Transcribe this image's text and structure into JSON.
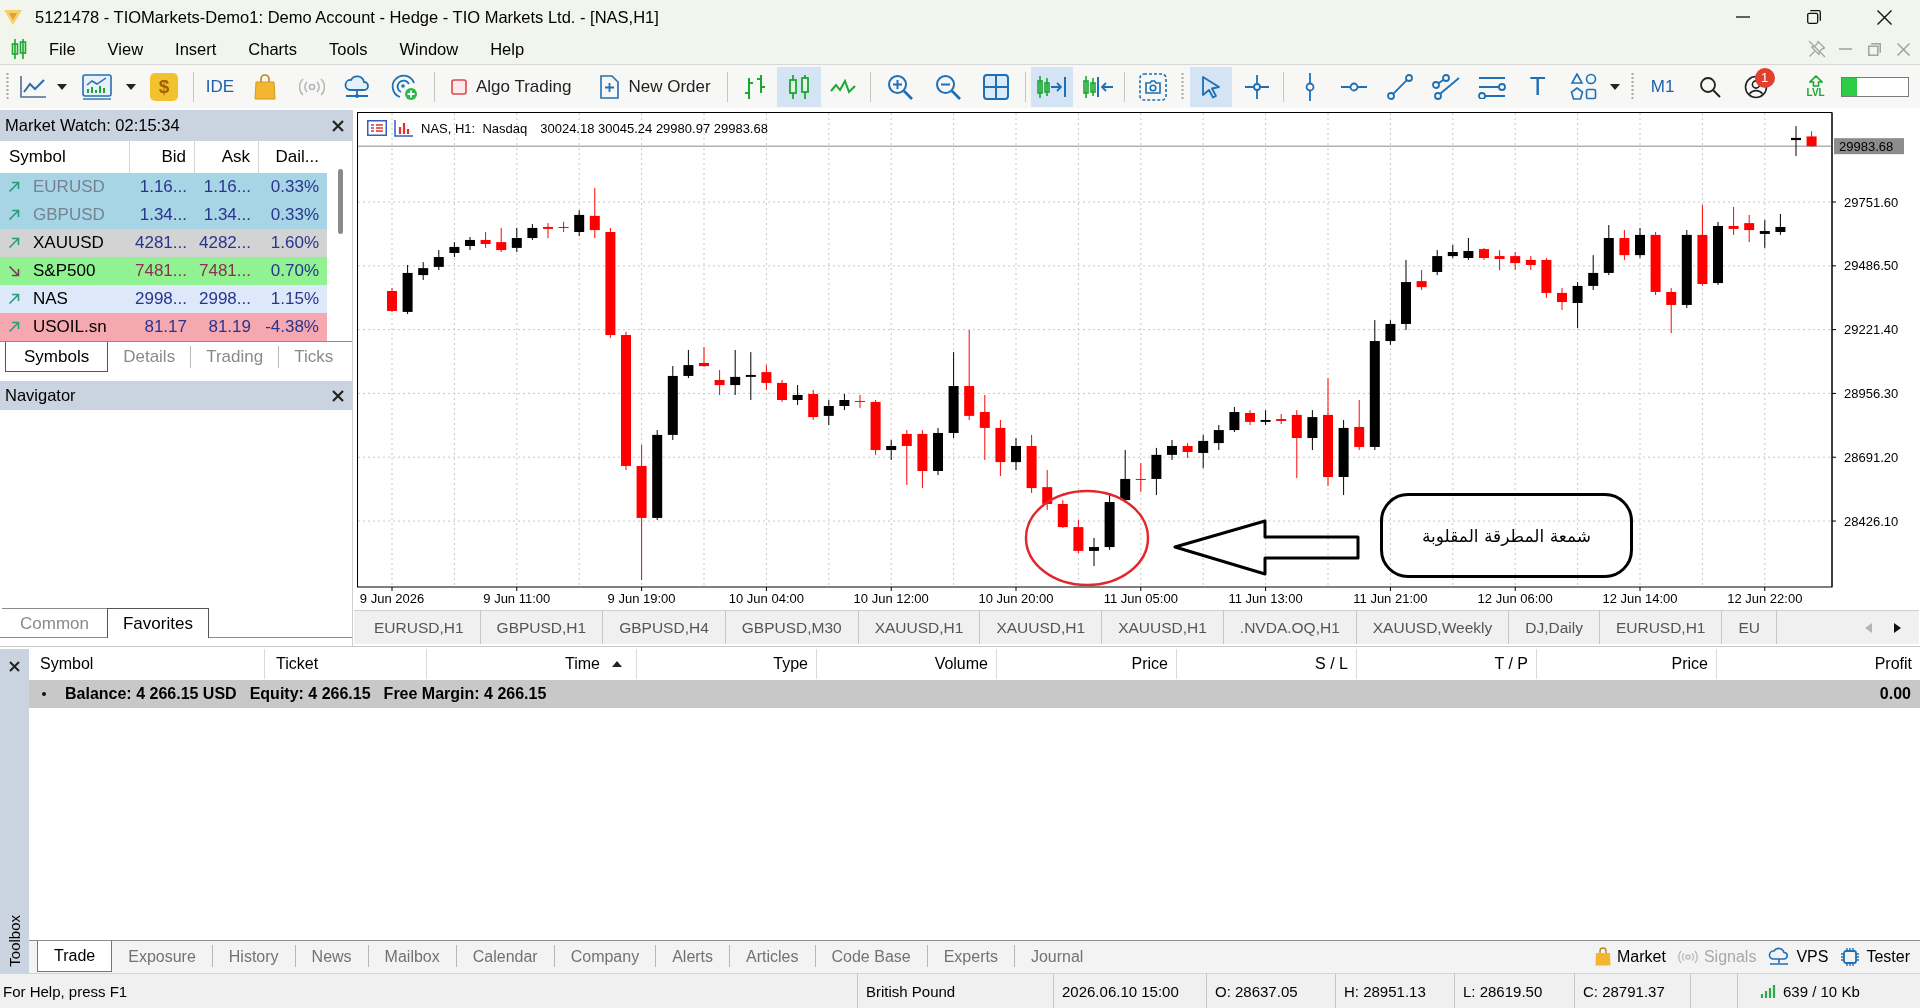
{
  "window": {
    "title": "5121478 - TIOMarkets-Demo1: Demo Account - Hedge - TIO Markets Ltd. - [NAS,H1]"
  },
  "menu": [
    "File",
    "View",
    "Insert",
    "Charts",
    "Tools",
    "Window",
    "Help"
  ],
  "toolbar": {
    "dollar_glyph": "$",
    "ide": "IDE",
    "algo_trading": {
      "label": "Algo Trading",
      "on": false
    },
    "new_order": "New Order",
    "chart_types": [
      {
        "kind": "bars",
        "selected": false
      },
      {
        "kind": "candles",
        "selected": true
      },
      {
        "kind": "line",
        "selected": false
      }
    ],
    "chart_shift": {
      "on": true
    },
    "autoscroll": {
      "on": false
    },
    "pointer_tools": [
      {
        "kind": "cursor",
        "selected": true
      },
      {
        "kind": "crosshair",
        "selected": false
      }
    ],
    "text_tool_glyph": "T",
    "timeframe": "M1",
    "notification_count": "1",
    "lvl": "LVL",
    "meter": {
      "level": 0.23
    }
  },
  "market_watch": {
    "title": "Market Watch: 02:15:34",
    "columns": [
      "Symbol",
      "Bid",
      "Ask",
      "Dail..."
    ],
    "rows": [
      {
        "symbol": "EURUSD",
        "bid": "1.16...",
        "ask": "1.16...",
        "daily": "0.33%",
        "rising": true,
        "dimmed": true,
        "color": "#a8d5e5"
      },
      {
        "symbol": "GBPUSD",
        "bid": "1.34...",
        "ask": "1.34...",
        "daily": "0.33%",
        "rising": true,
        "dimmed": true,
        "color": "#a8d5e5"
      },
      {
        "symbol": "XAUUSD",
        "bid": "4281...",
        "ask": "4282...",
        "daily": "1.60%",
        "rising": true,
        "dimmed": false,
        "color": "#d3d3d3"
      },
      {
        "symbol": "S&P500",
        "bid": "7481...",
        "ask": "7481...",
        "daily": "0.70%",
        "rising": false,
        "dimmed": false,
        "color": "#90f290"
      },
      {
        "symbol": "NAS",
        "bid": "2998...",
        "ask": "2998...",
        "daily": "1.15%",
        "rising": true,
        "dimmed": false,
        "color": "#dde9f8"
      },
      {
        "symbol": "USOIL.sn",
        "bid": "81.17",
        "ask": "81.19",
        "daily": "-4.38%",
        "rising": true,
        "dimmed": false,
        "color": "#f6a8b0"
      }
    ],
    "tabs": [
      {
        "label": "Symbols",
        "selected": true
      },
      {
        "label": "Details",
        "selected": false
      },
      {
        "label": "Trading",
        "selected": false
      },
      {
        "label": "Ticks",
        "selected": false
      }
    ]
  },
  "navigator": {
    "title": "Navigator",
    "tabs": [
      {
        "label": "Common",
        "selected": false
      },
      {
        "label": "Favorites",
        "selected": true
      }
    ]
  },
  "chart": {
    "header": "NAS, H1:  Nasdaq",
    "readout": "30024.18 30045.24 29980.97 29983.68",
    "chart_data": [
      {
        "type": "candlestick",
        "categories": [
          "9 Jun 2026",
          null,
          null,
          null,
          null,
          null,
          null,
          null,
          "9 Jun 11:00",
          null,
          null,
          null,
          null,
          null,
          null,
          null,
          "9 Jun 19:00",
          null,
          null,
          null,
          null,
          null,
          null,
          null,
          "10 Jun 04:00",
          null,
          null,
          null,
          null,
          null,
          null,
          null,
          "10 Jun 12:00",
          null,
          null,
          null,
          null,
          null,
          null,
          null,
          "10 Jun 20:00",
          null,
          null,
          null,
          null,
          null,
          null,
          null,
          "11 Jun 05:00",
          null,
          null,
          null,
          null,
          null,
          null,
          null,
          "11 Jun 13:00",
          null,
          null,
          null,
          null,
          null,
          null,
          null,
          "11 Jun 21:00",
          null,
          null,
          null,
          null,
          null,
          null,
          null,
          "12 Jun 06:00",
          null,
          null,
          null,
          null,
          null,
          null,
          null,
          "12 Jun 14:00",
          null,
          null,
          null,
          null,
          null,
          null,
          null,
          "12 Jun 22:00",
          null,
          null,
          null
        ],
        "ohlc": [
          [
            29382,
            29394,
            29295,
            29299
          ],
          [
            29295,
            29490,
            29286,
            29457
          ],
          [
            29448,
            29502,
            29428,
            29477
          ],
          [
            29482,
            29552,
            29469,
            29523
          ],
          [
            29540,
            29585,
            29523,
            29565
          ],
          [
            29569,
            29606,
            29552,
            29594
          ],
          [
            29594,
            29627,
            29561,
            29577
          ],
          [
            29585,
            29644,
            29544,
            29552
          ],
          [
            29561,
            29644,
            29544,
            29602
          ],
          [
            29602,
            29660,
            29594,
            29644
          ],
          [
            29648,
            29664,
            29602,
            29640
          ],
          [
            29648,
            29669,
            29627,
            29644
          ],
          [
            29627,
            29718,
            29610,
            29698
          ],
          [
            29694,
            29810,
            29602,
            29635
          ],
          [
            29627,
            29644,
            29187,
            29199
          ],
          [
            29199,
            29212,
            28638,
            28655
          ],
          [
            28655,
            28742,
            28181,
            28439
          ],
          [
            28439,
            28804,
            28430,
            28784
          ],
          [
            28784,
            29070,
            28763,
            29029
          ],
          [
            29029,
            29137,
            29020,
            29074
          ],
          [
            29083,
            29149,
            29066,
            29070
          ],
          [
            29012,
            29054,
            28950,
            28991
          ],
          [
            28991,
            29137,
            28950,
            29025
          ],
          [
            29025,
            29128,
            28929,
            29033
          ],
          [
            29045,
            29074,
            28971,
            29000
          ],
          [
            29000,
            29012,
            28921,
            28929
          ],
          [
            28929,
            28991,
            28908,
            28950
          ],
          [
            28954,
            28971,
            28846,
            28858
          ],
          [
            28863,
            28929,
            28825,
            28904
          ],
          [
            28904,
            28954,
            28887,
            28929
          ],
          [
            28925,
            28950,
            28896,
            28921
          ],
          [
            28921,
            28929,
            28701,
            28721
          ],
          [
            28721,
            28763,
            28680,
            28738
          ],
          [
            28788,
            28804,
            28576,
            28738
          ],
          [
            28788,
            28804,
            28563,
            28634
          ],
          [
            28634,
            28813,
            28617,
            28792
          ],
          [
            28792,
            29128,
            28771,
            28987
          ],
          [
            28987,
            29220,
            28846,
            28863
          ],
          [
            28879,
            28950,
            28680,
            28813
          ],
          [
            28813,
            28846,
            28613,
            28671
          ],
          [
            28671,
            28771,
            28638,
            28738
          ],
          [
            28738,
            28784,
            28543,
            28563
          ],
          [
            28567,
            28638,
            28472,
            28497
          ],
          [
            28497,
            28513,
            28397,
            28401
          ],
          [
            28401,
            28430,
            28293,
            28302
          ],
          [
            28302,
            28356,
            28239,
            28318
          ],
          [
            28318,
            28543,
            28306,
            28505
          ],
          [
            28513,
            28721,
            28501,
            28601
          ],
          [
            28601,
            28667,
            28547,
            28597
          ],
          [
            28601,
            28730,
            28534,
            28701
          ],
          [
            28701,
            28763,
            28680,
            28738
          ],
          [
            28738,
            28750,
            28688,
            28713
          ],
          [
            28709,
            28784,
            28646,
            28759
          ],
          [
            28750,
            28825,
            28721,
            28804
          ],
          [
            28804,
            28900,
            28796,
            28879
          ],
          [
            28875,
            28887,
            28825,
            28838
          ],
          [
            28838,
            28887,
            28825,
            28846
          ],
          [
            28850,
            28871,
            28829,
            28842
          ],
          [
            28867,
            28887,
            28605,
            28771
          ],
          [
            28771,
            28887,
            28721,
            28858
          ],
          [
            28867,
            29020,
            28572,
            28609
          ],
          [
            28609,
            28846,
            28534,
            28813
          ],
          [
            28817,
            28929,
            28721,
            28734
          ],
          [
            28734,
            29261,
            28721,
            29174
          ],
          [
            29174,
            29261,
            29158,
            29245
          ],
          [
            29245,
            29511,
            29220,
            29419
          ],
          [
            29423,
            29469,
            29386,
            29398
          ],
          [
            29461,
            29552,
            29448,
            29527
          ],
          [
            29527,
            29573,
            29519,
            29544
          ],
          [
            29519,
            29602,
            29511,
            29548
          ],
          [
            29556,
            29561,
            29511,
            29519
          ],
          [
            29527,
            29552,
            29469,
            29515
          ],
          [
            29527,
            29544,
            29469,
            29498
          ],
          [
            29511,
            29527,
            29469,
            29490
          ],
          [
            29511,
            29519,
            29353,
            29374
          ],
          [
            29374,
            29394,
            29303,
            29336
          ],
          [
            29332,
            29419,
            29228,
            29403
          ],
          [
            29403,
            29531,
            29386,
            29457
          ],
          [
            29457,
            29656,
            29448,
            29602
          ],
          [
            29602,
            29635,
            29511,
            29531
          ],
          [
            29531,
            29644,
            29519,
            29615
          ],
          [
            29615,
            29627,
            29365,
            29378
          ],
          [
            29378,
            29394,
            29207,
            29324
          ],
          [
            29324,
            29635,
            29311,
            29615
          ],
          [
            29615,
            29739,
            29403,
            29411
          ],
          [
            29415,
            29669,
            29407,
            29652
          ],
          [
            29652,
            29731,
            29615,
            29640
          ],
          [
            29664,
            29698,
            29585,
            29635
          ],
          [
            29619,
            29677,
            29561,
            29631
          ],
          [
            29627,
            29702,
            29615,
            29648
          ],
          [
            30009,
            30067,
            29943,
            30018
          ],
          [
            30024.18,
            30045.24,
            29980.97,
            29983.68
          ]
        ],
        "yticks": [
          {
            "value": 28426.1,
            "label": "28426.10"
          },
          {
            "value": 28691.2,
            "label": "28691.20"
          },
          {
            "value": 28956.3,
            "label": "28956.30"
          },
          {
            "value": 29221.4,
            "label": "29221.40"
          },
          {
            "value": 29486.5,
            "label": "29486.50"
          },
          {
            "value": 29751.6,
            "label": "29751.60"
          }
        ],
        "ylim": [
          28152,
          30134
        ],
        "grid": true,
        "ref_lines": [
          {
            "axis": "y",
            "value": 29983.68,
            "label": "29983.68",
            "color": "#8c8c8c"
          }
        ],
        "annotations": [
          "شمعة المطرقة المقلوبة"
        ]
      }
    ]
  },
  "chart_tabs": {
    "tabs": [
      {
        "label": "EURUSD,H1",
        "selected": false
      },
      {
        "label": "GBPUSD,H1",
        "selected": false
      },
      {
        "label": "GBPUSD,H4",
        "selected": false
      },
      {
        "label": "GBPUSD,M30",
        "selected": false
      },
      {
        "label": "XAUUSD,H1",
        "selected": false
      },
      {
        "label": "XAUUSD,H1",
        "selected": false
      },
      {
        "label": "XAUUSD,H1",
        "selected": false
      },
      {
        "label": ".NVDA.OQ,H1",
        "selected": false
      },
      {
        "label": "XAUUSD,Weekly",
        "selected": false
      },
      {
        "label": "DJ,Daily",
        "selected": false
      },
      {
        "label": "EURUSD,H1",
        "selected": false
      },
      {
        "label": "EU",
        "selected": false
      }
    ],
    "scroll_left": {
      "disabled": true
    },
    "scroll_right": {
      "disabled": false
    }
  },
  "trade": {
    "columns": [
      {
        "label": "Symbol",
        "sorted": false
      },
      {
        "label": "Ticket",
        "sorted": false
      },
      {
        "label": "Time",
        "sorted": true
      },
      {
        "label": "Type",
        "sorted": false
      },
      {
        "label": "Volume",
        "sorted": false
      },
      {
        "label": "Price",
        "sorted": false
      },
      {
        "label": "S / L",
        "sorted": false
      },
      {
        "label": "T / P",
        "sorted": false
      },
      {
        "label": "Price",
        "sorted": false
      },
      {
        "label": "Profit",
        "sorted": false
      }
    ],
    "summary": [
      "Balance: 4 266.15 USD",
      "Equity: 4 266.15",
      "Free Margin: 4 266.15"
    ],
    "profit": "0.00"
  },
  "toolbox": {
    "label": "Toolbox",
    "tabs": [
      {
        "label": "Trade",
        "selected": true
      },
      {
        "label": "Exposure",
        "selected": false
      },
      {
        "label": "History",
        "selected": false
      },
      {
        "label": "News",
        "selected": false
      },
      {
        "label": "Mailbox",
        "selected": false
      },
      {
        "label": "Calendar",
        "selected": false
      },
      {
        "label": "Company",
        "selected": false
      },
      {
        "label": "Alerts",
        "selected": false
      },
      {
        "label": "Articles",
        "selected": false
      },
      {
        "label": "Code Base",
        "selected": false
      },
      {
        "label": "Experts",
        "selected": false
      },
      {
        "label": "Journal",
        "selected": false
      }
    ],
    "services": [
      {
        "kind": "market",
        "label": "Market",
        "disabled": false
      },
      {
        "kind": "signals",
        "label": "Signals",
        "disabled": true
      },
      {
        "kind": "vps",
        "label": "VPS",
        "disabled": false
      },
      {
        "kind": "tester",
        "label": "Tester",
        "disabled": false
      }
    ]
  },
  "status_bar": {
    "help": "For Help, press F1",
    "fields": [
      "British Pound",
      "2026.06.10 15:00",
      "O: 28637.05",
      "H: 28951.13",
      "L: 28619.50",
      "C: 28791.37"
    ],
    "traffic": "639 / 10 Kb"
  }
}
